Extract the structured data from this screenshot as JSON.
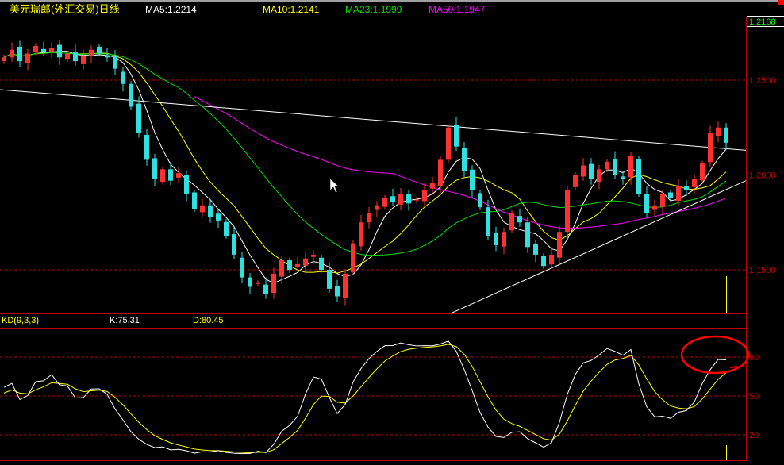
{
  "header": {
    "title": "美元瑞郎(外汇交易)日线",
    "ma5": "MA5:1.2214",
    "ma10": "MA10:1.2141",
    "ma23": "MA23:1.1999",
    "ma50": "MA50:1.1947"
  },
  "last_price": "1.2168",
  "kd_header": {
    "name": "KD(9,3,3)",
    "k": "K:75.31",
    "d": "D:80.45"
  },
  "colors": {
    "up": "#ff3030",
    "down": "#30e0e0",
    "ma5": "#ffffff",
    "ma10": "#ffff00",
    "ma23": "#00e000",
    "ma50": "#ff00ff",
    "grid": "#c00000",
    "k": "#ffffff",
    "d": "#ffff00",
    "annotation": "#ff0000"
  },
  "chart_data": [
    {
      "type": "candlestick",
      "title": "美元瑞郎(外汇交易)日线",
      "ylim": [
        1.127,
        1.283
      ],
      "yticks": [
        "1.2500",
        "1.2000",
        "1.1500"
      ],
      "ytick_values": [
        1.25,
        1.2,
        1.15
      ],
      "grid": true,
      "close": [
        1.262,
        1.266,
        1.26,
        1.264,
        1.268,
        1.265,
        1.267,
        1.262,
        1.264,
        1.26,
        1.263,
        1.266,
        1.264,
        1.262,
        1.256,
        1.248,
        1.236,
        1.222,
        1.208,
        1.198,
        1.203,
        1.197,
        1.201,
        1.19,
        1.182,
        1.184,
        1.178,
        1.176,
        1.168,
        1.158,
        1.146,
        1.141,
        1.143,
        1.137,
        1.148,
        1.155,
        1.15,
        1.153,
        1.156,
        1.158,
        1.15,
        1.14,
        1.136,
        1.148,
        1.164,
        1.175,
        1.18,
        1.184,
        1.188,
        1.186,
        1.19,
        1.185,
        1.187,
        1.192,
        1.196,
        1.208,
        1.225,
        1.215,
        1.202,
        1.192,
        1.183,
        1.168,
        1.163,
        1.17,
        1.18,
        1.175,
        1.162,
        1.158,
        1.152,
        1.158,
        1.17,
        1.192,
        1.2,
        1.205,
        1.198,
        1.203,
        1.207,
        1.2,
        1.198,
        1.21,
        1.19,
        1.18,
        1.184,
        1.19,
        1.188,
        1.194,
        1.192,
        1.198,
        1.206,
        1.222,
        1.225,
        1.217
      ],
      "moving_averages": [
        {
          "name": "MA5",
          "period": 5
        },
        {
          "name": "MA10",
          "period": 10
        },
        {
          "name": "MA23",
          "period": 23
        },
        {
          "name": "MA50",
          "period": 50
        }
      ],
      "trendlines": [
        {
          "from": [
            -0.5,
            1.245
          ],
          "to": [
            93.5,
            1.213
          ]
        },
        {
          "from": [
            56.3,
            1.127
          ],
          "to": [
            93.5,
            1.197
          ]
        }
      ]
    },
    {
      "type": "line",
      "title": "KD(9,3,3)",
      "ylim": [
        0,
        100
      ],
      "yticks": [
        "80",
        "50",
        "20"
      ],
      "ytick_values": [
        80,
        50,
        20
      ],
      "series": [
        {
          "name": "K",
          "last": 75.31
        },
        {
          "name": "D",
          "last": 80.45
        }
      ]
    }
  ]
}
